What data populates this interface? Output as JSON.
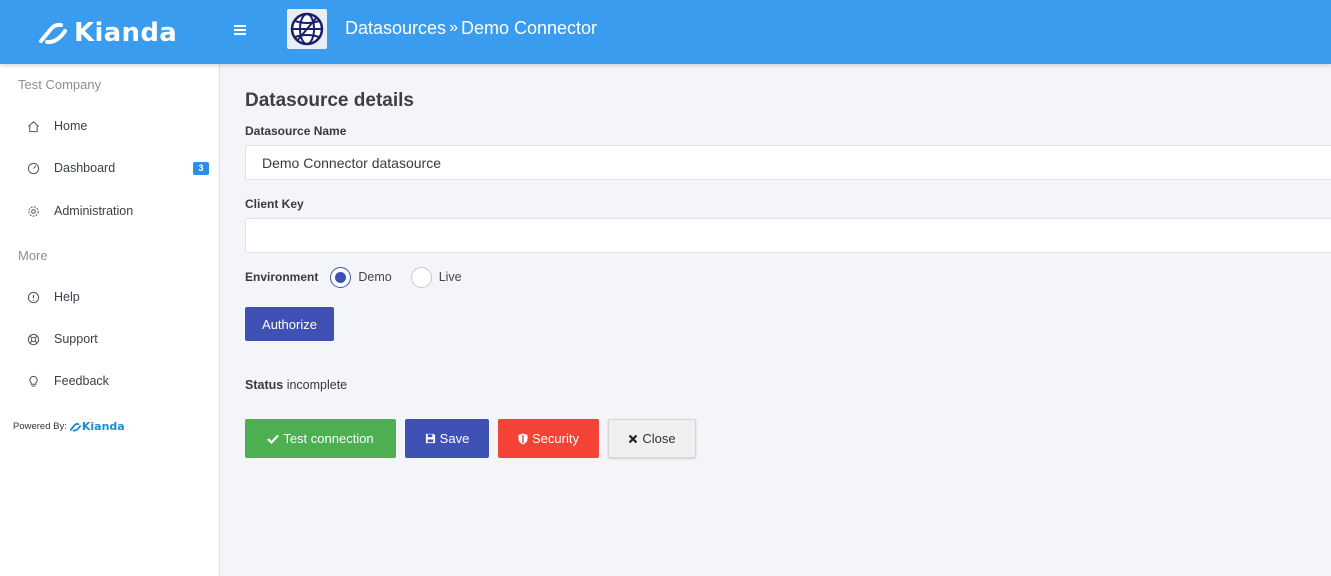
{
  "header": {
    "logo_text": "Kianda",
    "breadcrumb": {
      "parent": "Datasources",
      "separator": "»",
      "current": "Demo Connector"
    },
    "icons": {
      "menu": "hamburger-icon",
      "app": "globe-icon"
    },
    "colors": {
      "bar": "#3a9cee"
    }
  },
  "sidebar": {
    "company": "Test Company",
    "main_items": [
      {
        "label": "Home",
        "icon": "home-icon"
      },
      {
        "label": "Dashboard",
        "icon": "dashboard-icon",
        "badge": "3"
      },
      {
        "label": "Administration",
        "icon": "gear-icon"
      }
    ],
    "more_title": "More",
    "more_items": [
      {
        "label": "Help",
        "icon": "info-icon"
      },
      {
        "label": "Support",
        "icon": "lifebuoy-icon"
      },
      {
        "label": "Feedback",
        "icon": "lightbulb-icon"
      }
    ],
    "powered_by": "Powered By:",
    "powered_logo": "Kianda"
  },
  "main": {
    "heading": "Datasource details",
    "name_label": "Datasource Name",
    "name_value": "Demo Connector datasource",
    "key_label": "Client Key",
    "key_value": "",
    "environment_label": "Environment",
    "environment_options": [
      {
        "label": "Demo",
        "selected": true
      },
      {
        "label": "Live",
        "selected": false
      }
    ],
    "authorize_label": "Authorize",
    "status_label": "Status",
    "status_value": "incomplete",
    "buttons": {
      "test": "Test connection",
      "save": "Save",
      "security": "Security",
      "close": "Close"
    },
    "colors": {
      "primary": "#3f51b5",
      "success": "#4caf50",
      "danger": "#f44336"
    }
  }
}
